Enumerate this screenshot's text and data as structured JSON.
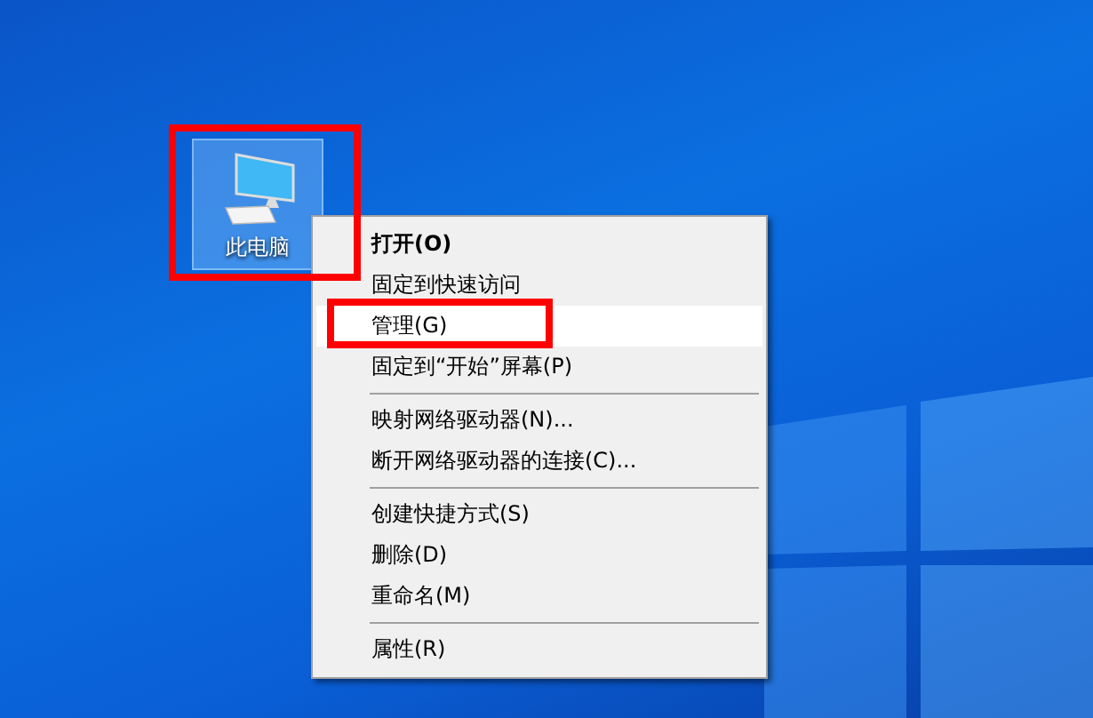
{
  "desktop_icon": {
    "label": "此电脑",
    "selected": true,
    "highlighted": true
  },
  "context_menu": {
    "groups": [
      [
        {
          "label": "打开(O)",
          "default": true,
          "hovered": false,
          "highlighted": false
        },
        {
          "label": "固定到快速访问",
          "default": false,
          "hovered": false,
          "highlighted": false
        },
        {
          "label": "管理(G)",
          "default": false,
          "hovered": true,
          "highlighted": true
        },
        {
          "label": "固定到“开始”屏幕(P)",
          "default": false,
          "hovered": false,
          "highlighted": false
        }
      ],
      [
        {
          "label": "映射网络驱动器(N)...",
          "default": false,
          "hovered": false,
          "highlighted": false
        },
        {
          "label": "断开网络驱动器的连接(C)...",
          "default": false,
          "hovered": false,
          "highlighted": false
        }
      ],
      [
        {
          "label": "创建快捷方式(S)",
          "default": false,
          "hovered": false,
          "highlighted": false
        },
        {
          "label": "删除(D)",
          "default": false,
          "hovered": false,
          "highlighted": false
        },
        {
          "label": "重命名(M)",
          "default": false,
          "hovered": false,
          "highlighted": false
        }
      ],
      [
        {
          "label": "属性(R)",
          "default": false,
          "hovered": false,
          "highlighted": false
        }
      ]
    ]
  }
}
